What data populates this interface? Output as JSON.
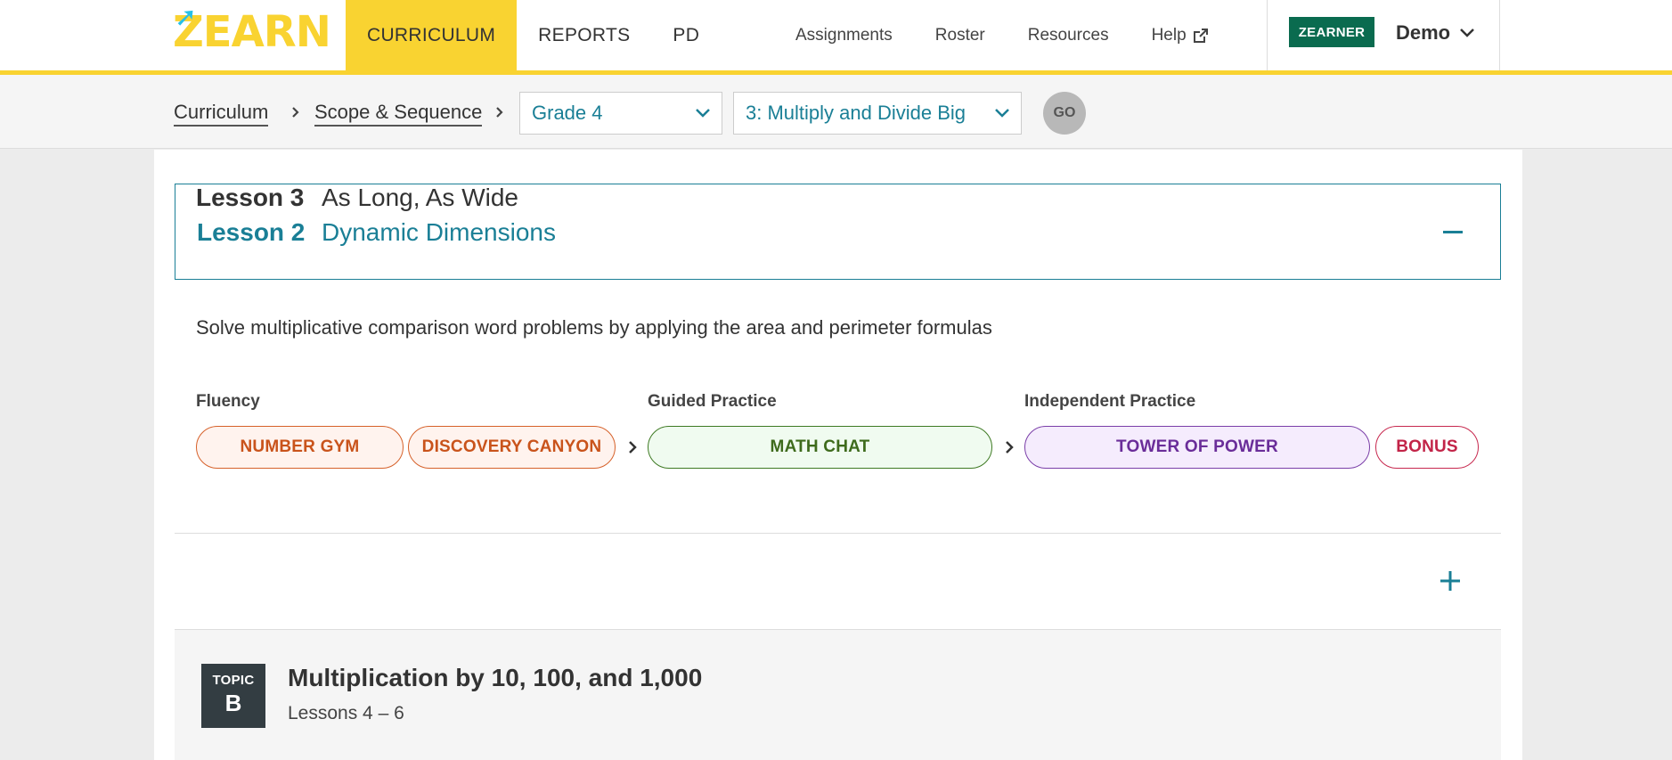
{
  "header": {
    "logo_text": "ZEARN",
    "nav": [
      "CURRICULUM",
      "REPORTS",
      "PD"
    ],
    "active_nav": "CURRICULUM",
    "links": [
      "Assignments",
      "Roster",
      "Resources",
      "Help"
    ],
    "badge": "ZEARNER",
    "user": "Demo"
  },
  "breadcrumb": {
    "items": [
      "Curriculum",
      "Scope & Sequence"
    ],
    "grade_select": "Grade 4",
    "module_select": "3: Multiply and Divide Big",
    "go_label": "GO"
  },
  "lesson2": {
    "number": "Lesson 2",
    "title": "Dynamic Dimensions",
    "description": "Solve multiplicative comparison word problems by applying the area and perimeter formulas",
    "groups": {
      "fluency": "Fluency",
      "guided": "Guided Practice",
      "independent": "Independent Practice"
    },
    "activities": {
      "number_gym": "NUMBER GYM",
      "discovery_canyon": "DISCOVERY CANYON",
      "math_chat": "MATH CHAT",
      "tower_of_power": "TOWER OF POWER",
      "bonus": "BONUS"
    }
  },
  "lesson3": {
    "number": "Lesson 3",
    "title": "As Long, As Wide"
  },
  "topic": {
    "badge_label": "TOPIC",
    "badge_letter": "B",
    "title": "Multiplication by 10, 100, and 1,000",
    "subtitle": "Lessons 4 – 6"
  },
  "colors": {
    "accent_yellow": "#f9d331",
    "teal": "#1a7f96",
    "badge_green": "#0a6b4f"
  },
  "icons": [
    "help-external-link-icon",
    "user-chevron-down-icon",
    "breadcrumb-chevron-icon",
    "select-chevron-icon",
    "collapse-minus-icon",
    "expand-plus-icon",
    "activity-arrow-icon"
  ]
}
